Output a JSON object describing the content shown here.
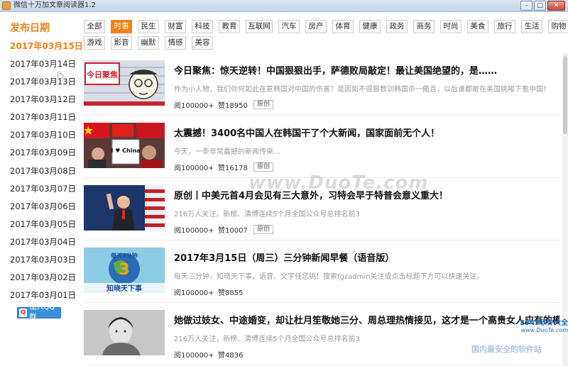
{
  "window": {
    "title": "微信十万加文章阅读器1.2",
    "minimize": "–",
    "maximize": "□",
    "close": "✕"
  },
  "sidebar": {
    "title": "发布日期",
    "dates": [
      "2017年03月15日",
      "2017年03月14日",
      "2017年03月13日",
      "2017年03月12日",
      "2017年03月11日",
      "2017年03月10日",
      "2017年03月09日",
      "2017年03月08日",
      "2017年03月07日",
      "2017年03月06日",
      "2017年03月05日",
      "2017年03月04日",
      "2017年03月03日",
      "2017年03月02日",
      "2017年03月01日"
    ],
    "active_date": "2017年03月15日",
    "qq_button": "加入QQ群"
  },
  "tabs": [
    "全部",
    "时事",
    "民生",
    "财富",
    "科技",
    "教育",
    "互联网",
    "汽车",
    "房产",
    "体育",
    "健康",
    "政务",
    "商务",
    "时尚",
    "美食",
    "旅行",
    "生活",
    "购物",
    "游戏",
    "影音",
    "幽默",
    "情感",
    "美容"
  ],
  "active_tab": "时事",
  "articles": [
    {
      "title": "今日聚焦：惊天逆转！中国狠狠出手，萨德败局敲定！最让美国绝望的，是……",
      "desc": "作为小人物，我们你何如此在意韩国对中国的伤害？是因如不很狠数训韩国杀一儆百，以后谁都敢在美国挑唆下惹中国！",
      "views": "阅100000+",
      "likes": "赞18950",
      "badge": "原创"
    },
    {
      "title": "太震撼！3400名中国人在韩国干了个大新闻，国家面前无个人！",
      "desc": "今天，一条非常震撼的新闻传来…",
      "views": "阅100000+",
      "likes": "赞16178",
      "badge": "原创"
    },
    {
      "title": "原创丨中美元首4月会见有三大意外，习特会早于特普会意义重大！",
      "desc": "216万人关注，新榜、清博连续5个月全国公众号总排名前3",
      "views": "阅100000+",
      "likes": "赞10007",
      "badge": "原创"
    },
    {
      "title": "2017年3月15日（周三）三分钟新闻早餐（语音版）",
      "desc": "每天三分钟，知晓天下事，语音、文字任您挑！搜索fgzadmin关注或点击标题下方可以快速关注。",
      "views": "阅100000+",
      "likes": "赞8855",
      "badge": ""
    },
    {
      "title": "她做过妓女、中途婚变，却让杜月笙敬她三分、周总理热情接见，这才是一个高贵女人应有的模样",
      "desc": "216万人关注，新榜、清博连续5个月全国公众号总排名前3",
      "views": "阅100000+",
      "likes": "赞4836",
      "badge": ""
    }
  ],
  "thumb_texts": {
    "first": "今日聚焦",
    "second": "I ♥ China",
    "fourth_top": "每天3分钟",
    "fourth_bottom": "知晓天下事"
  },
  "watermarks": {
    "center": "www.DuoTe.com",
    "corner_line1": "2345软件大全",
    "corner_line2": "www.DuoTe.com",
    "bottom": "国内最安全的软件站"
  }
}
